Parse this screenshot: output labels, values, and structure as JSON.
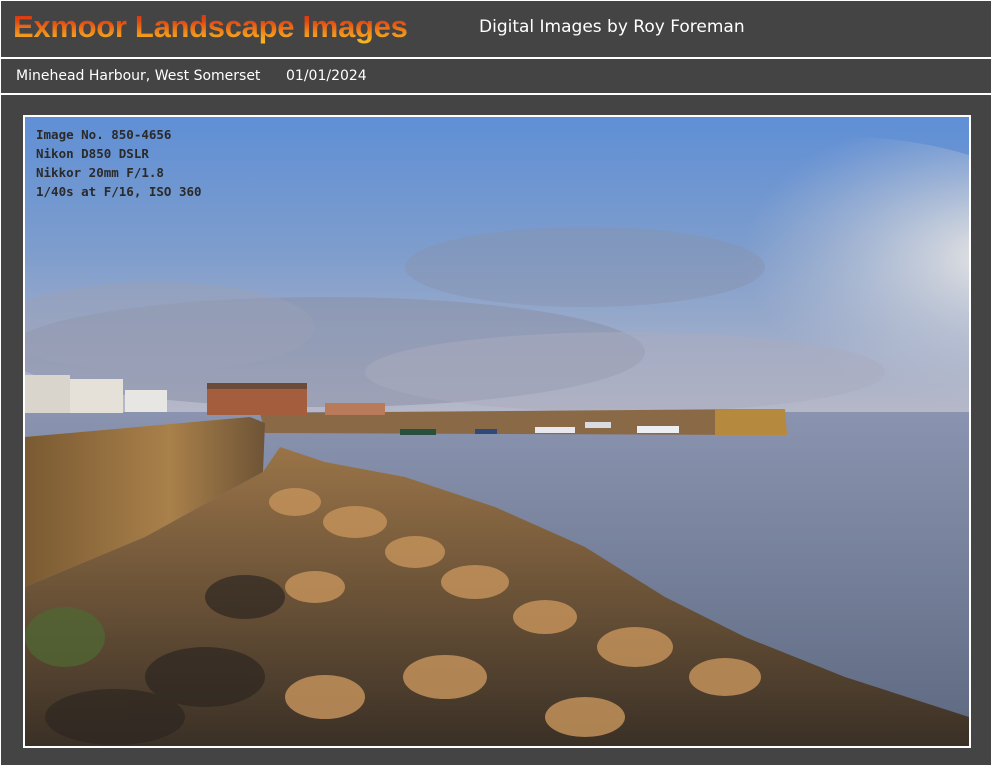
{
  "header": {
    "site_title": "Exmoor Landscape Images",
    "subtitle": "Digital Images by Roy Foreman"
  },
  "caption": {
    "location": "Minehead Harbour, West Somerset",
    "date": "01/01/2024"
  },
  "photo": {
    "exif": {
      "image_no": "Image No. 850-4656",
      "camera": "Nikon D850 DSLR",
      "lens": "Nikkor 20mm F/1.8",
      "exposure": "1/40s at F/16, ISO 360"
    }
  },
  "colors": {
    "panel_background": "#444444",
    "title_gradient_top": "#d42a10",
    "title_gradient_bottom": "#f7c322",
    "text": "#ffffff"
  }
}
